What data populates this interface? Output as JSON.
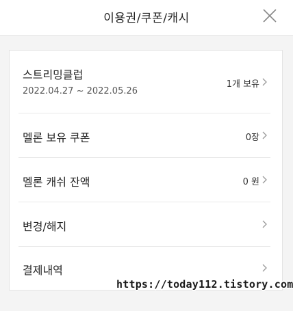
{
  "header": {
    "title": "이용권/쿠폰/캐시",
    "close_icon": "close-icon"
  },
  "items": [
    {
      "label": "스트리밍클럽",
      "sub": "2022.04.27 ~ 2022.05.26",
      "value": "1개 보유"
    },
    {
      "label": "멜론 보유 쿠폰",
      "value": "0장"
    },
    {
      "label": "멜론 캐쉬 잔액",
      "value": "0 원"
    },
    {
      "label": "변경/해지",
      "value": ""
    },
    {
      "label": "결제내역",
      "value": ""
    }
  ],
  "watermark": "https://today112.tistory.com",
  "colors": {
    "highlight": "#fdb9bb",
    "background": "#f4f4f4",
    "panel": "#ffffff",
    "divider": "#e8e8e8"
  }
}
